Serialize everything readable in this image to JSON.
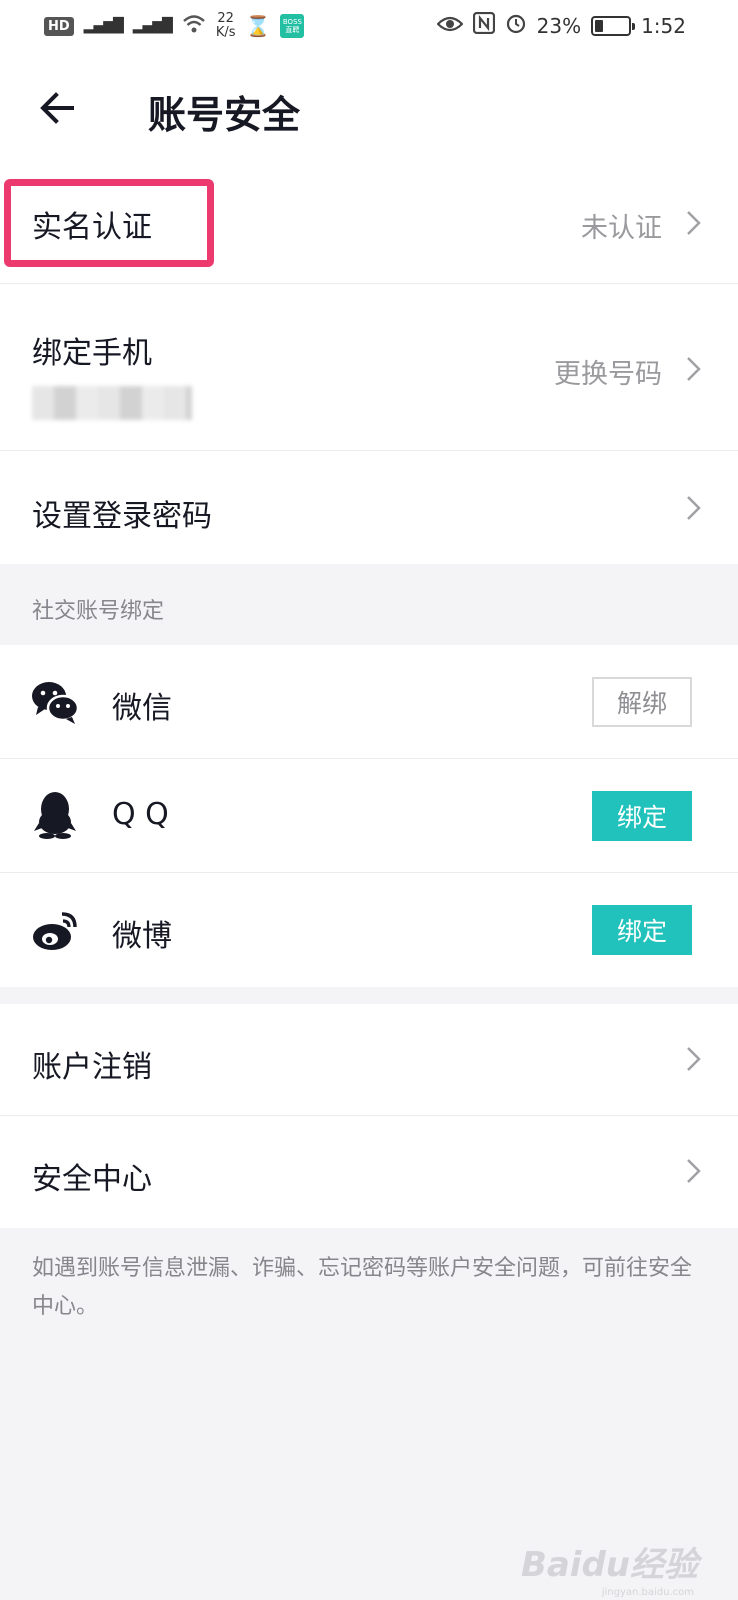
{
  "status_bar": {
    "hd": "HD",
    "speed_value": "22",
    "speed_unit": "K/s",
    "boss_badge": "BOSS直聘",
    "battery": "23%",
    "time": "1:52"
  },
  "header": {
    "title": "账号安全"
  },
  "rows": {
    "real_name": {
      "label": "实名认证",
      "value": "未认证"
    },
    "bind_phone": {
      "label": "绑定手机",
      "value": "更换号码"
    },
    "login_password": {
      "label": "设置登录密码"
    }
  },
  "social": {
    "section_title": "社交账号绑定",
    "items": [
      {
        "label": "微信",
        "button": "解绑",
        "icon": "wechat-icon",
        "button_style": "outline"
      },
      {
        "label": "Q Q",
        "button": "绑定",
        "icon": "qq-icon",
        "button_style": "solid"
      },
      {
        "label": "微博",
        "button": "绑定",
        "icon": "weibo-icon",
        "button_style": "solid"
      }
    ]
  },
  "rows2": {
    "account_cancel": {
      "label": "账户注销"
    },
    "security_center": {
      "label": "安全中心"
    }
  },
  "tip": "如遇到账号信息泄漏、诈骗、忘记密码等账户安全问题，可前往安全中心。",
  "watermark": {
    "main": "Baidu经验",
    "sub": "jingyan.baidu.com"
  },
  "colors": {
    "accent": "#20c2bb",
    "highlight": "#ec3a6f",
    "background": "#f4f4f6",
    "muted_text": "#9a9a9e"
  }
}
